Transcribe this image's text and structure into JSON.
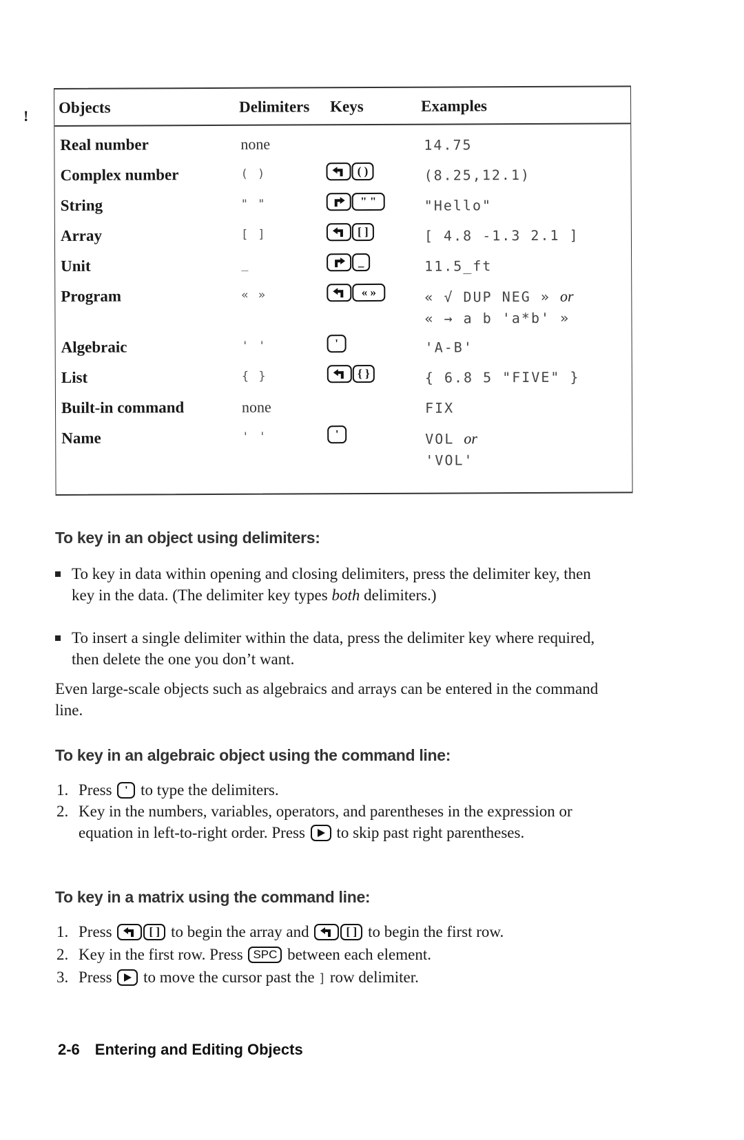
{
  "margin_mark": "!",
  "table": {
    "headers": [
      "Objects",
      "Delimiters",
      "Keys",
      "Examples"
    ],
    "rows": [
      {
        "object": "Real number",
        "delimiters": "none",
        "keys": [],
        "examples": [
          "14.75"
        ]
      },
      {
        "object": "Complex number",
        "delimiters": "( )",
        "keys": [
          "left-shift-icon",
          "( )"
        ],
        "examples": [
          "(8.25,12.1)"
        ]
      },
      {
        "object": "String",
        "delimiters": "\" \"",
        "keys": [
          "right-shift-icon",
          "\" \""
        ],
        "examples": [
          "\"Hello\""
        ]
      },
      {
        "object": "Array",
        "delimiters": "[ ]",
        "keys": [
          "left-shift-icon",
          "[ ]"
        ],
        "examples": [
          "[ 4.8 -1.3 2.1 ]"
        ]
      },
      {
        "object": "Unit",
        "delimiters": "_",
        "keys": [
          "right-shift-icon",
          "_"
        ],
        "examples": [
          "11.5_ft"
        ]
      },
      {
        "object": "Program",
        "delimiters": "« »",
        "keys": [
          "left-shift-icon",
          "« »"
        ],
        "examples": [
          "« √ DUP NEG »",
          "« → a b 'a*b' »"
        ],
        "example_joiner": "or"
      },
      {
        "object": "Algebraic",
        "delimiters": "' '",
        "keys": [
          "'"
        ],
        "examples": [
          "'A-B'"
        ]
      },
      {
        "object": "List",
        "delimiters": "{ }",
        "keys": [
          "left-shift-icon",
          "{ }"
        ],
        "examples": [
          "{ 6.8 5 \"FIVE\" }"
        ]
      },
      {
        "object": "Built-in command",
        "delimiters": "none",
        "keys": [],
        "examples": [
          "FIX"
        ]
      },
      {
        "object": "Name",
        "delimiters": "' '",
        "keys": [
          "'"
        ],
        "examples": [
          "VOL",
          "'VOL'"
        ],
        "example_joiner": "or"
      }
    ]
  },
  "sections": [
    {
      "heading": "To key in an object using delimiters:",
      "bullets": [
        {
          "text_before": "To key in data within opening and closing delimiters, press the delimiter key, then key in the data. (The delimiter key types ",
          "italic": "both",
          "text_after": " delimiters.)"
        },
        {
          "text": "To insert a single delimiter within the data, press the delimiter key where required, then delete the one you don’t want."
        }
      ],
      "paragraph": "Even large-scale objects such as algebraics and arrays can be entered in the command line."
    },
    {
      "heading": "To key in an algebraic object using the command line:",
      "steps": [
        {
          "num": "1.",
          "before": "Press",
          "key": "'",
          "after": "to type the delimiters."
        },
        {
          "num": "2.",
          "before": "Key in the numbers, variables, operators, and parentheses in the expression or equation in left-to-right order. Press",
          "key": "right-arrow-icon",
          "after": "to skip past right parentheses."
        }
      ]
    },
    {
      "heading": "To key in a matrix using the command line:",
      "steps": [
        {
          "num": "1.",
          "before": "Press",
          "key1": "[ ]",
          "middle": "to begin the array and",
          "key2": "[ ]",
          "after": "to begin the first row."
        },
        {
          "num": "2.",
          "before": "Key in the first row. Press",
          "key": "SPC",
          "after": "between each element."
        },
        {
          "num": "3.",
          "before": "Press",
          "key": "right-arrow-icon",
          "after": "to move the cursor past the",
          "mono": "]",
          "after2": "row delimiter."
        }
      ]
    }
  ],
  "footer": {
    "page": "2-6",
    "title": "Entering and Editing Objects"
  }
}
